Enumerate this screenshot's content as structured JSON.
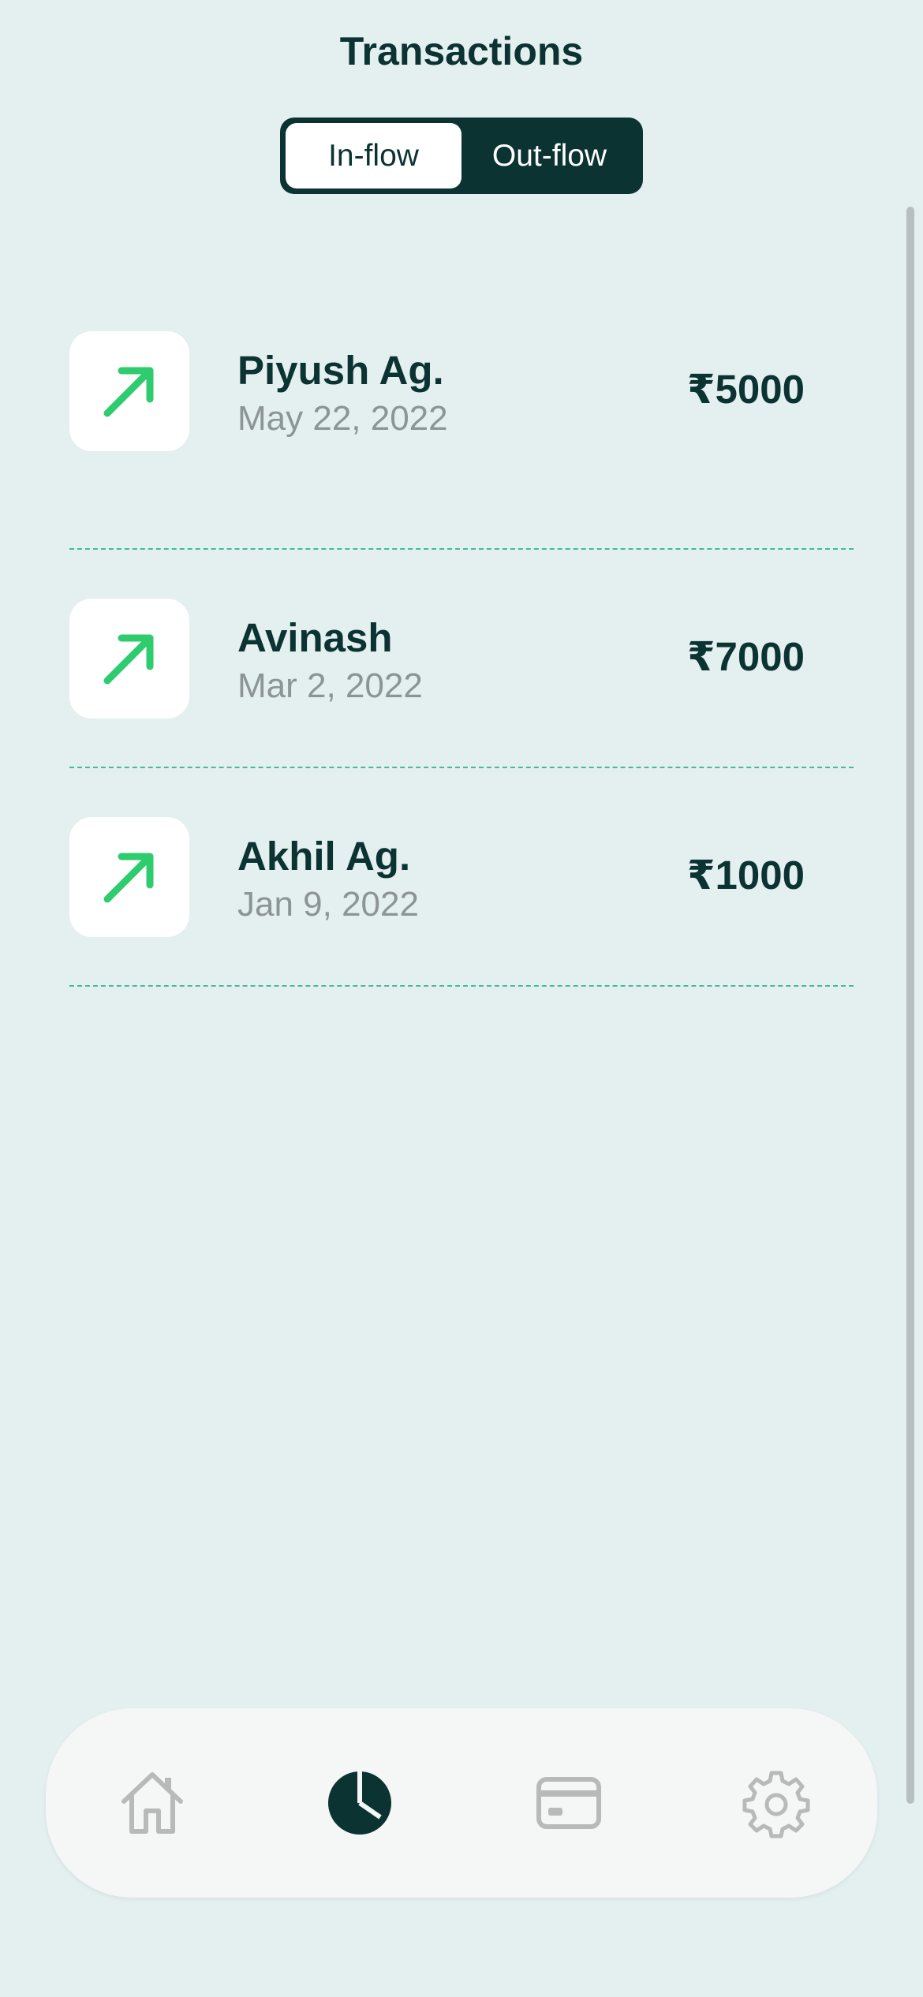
{
  "header": {
    "title": "Transactions"
  },
  "segmented_control": {
    "options": [
      "In-flow",
      "Out-flow"
    ],
    "selected": "In-flow"
  },
  "transactions": [
    {
      "name": "Piyush Ag.",
      "date": "May 22, 2022",
      "amount": "₹5000",
      "icon": "arrow-up-right-icon"
    },
    {
      "name": "Avinash",
      "date": "Mar 2, 2022",
      "amount": "₹7000",
      "icon": "arrow-up-right-icon"
    },
    {
      "name": "Akhil Ag.",
      "date": "Jan 9, 2022",
      "amount": "₹1000",
      "icon": "arrow-up-right-icon"
    }
  ],
  "tab_bar": {
    "items": [
      {
        "icon": "home-icon",
        "active": false
      },
      {
        "icon": "pie-chart-icon",
        "active": true
      },
      {
        "icon": "card-icon",
        "active": false
      },
      {
        "icon": "gear-icon",
        "active": false
      }
    ]
  },
  "colors": {
    "background": "#e4eff0",
    "primary": "#0b3332",
    "accent_green": "#2ecc6e",
    "divider": "#3fbd9b",
    "inactive_icon": "#b8baba"
  }
}
